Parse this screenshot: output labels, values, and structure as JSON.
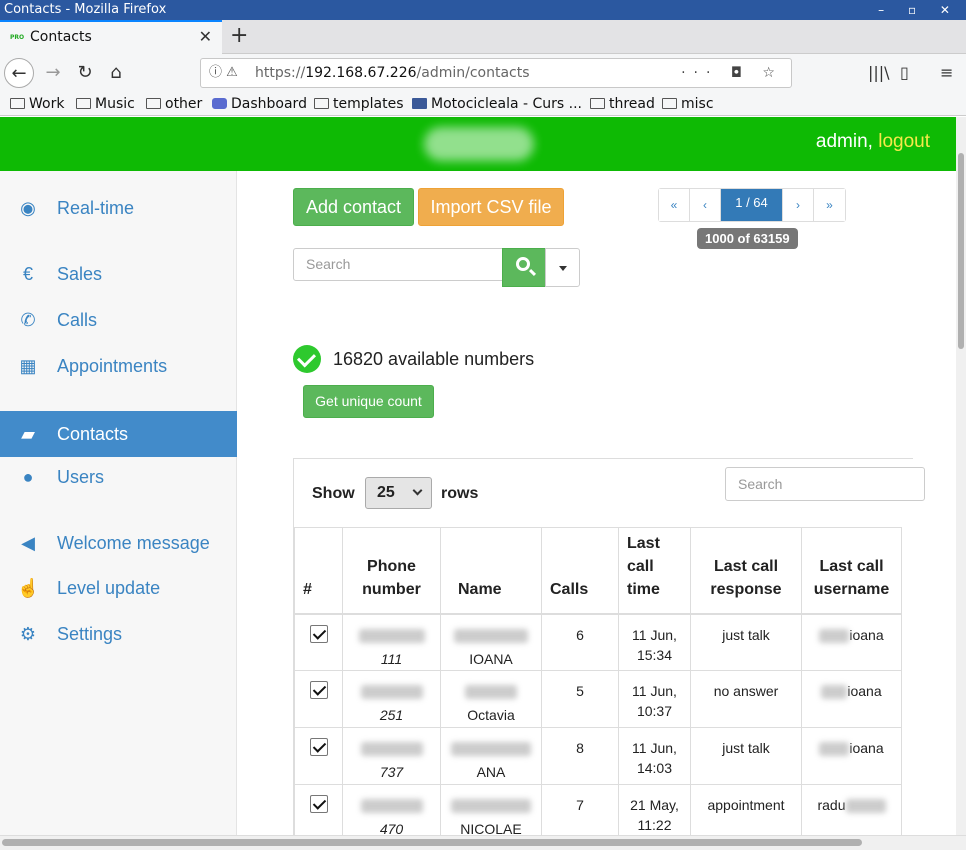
{
  "window": {
    "title": "Contacts - Mozilla Firefox"
  },
  "tab": {
    "title": "Contacts",
    "favicon_text": "PRO"
  },
  "url": {
    "prefix": "https://",
    "host": "192.168.67.226",
    "path": "/admin/contacts"
  },
  "bookmarks": [
    "Work",
    "Music",
    "other",
    "Dashboard",
    "templates",
    "Motocicleala - Curs ...",
    "thread",
    "misc"
  ],
  "header": {
    "user": "admin,",
    "logout": "logout",
    "color": "#0eba04"
  },
  "sidebar": {
    "items": [
      {
        "label": "Real-time",
        "icon": "eye-icon"
      },
      {
        "label": "Sales",
        "icon": "euro-icon"
      },
      {
        "label": "Calls",
        "icon": "phone-icon"
      },
      {
        "label": "Appointments",
        "icon": "calendar-icon"
      },
      {
        "label": "Contacts",
        "icon": "briefcase-icon",
        "active": true
      },
      {
        "label": "Users",
        "icon": "user-icon"
      },
      {
        "label": "Welcome message",
        "icon": "megaphone-icon"
      },
      {
        "label": "Level update",
        "icon": "thumbs-up-icon"
      },
      {
        "label": "Settings",
        "icon": "gear-icon"
      }
    ]
  },
  "toolbar": {
    "add_contact": "Add contact",
    "import_csv": "Import CSV file",
    "search_placeholder": "Search"
  },
  "pagination": {
    "first": "«",
    "prev": "‹",
    "current": "1 / 64",
    "next": "›",
    "last": "»",
    "count_badge": "1000 of 63159"
  },
  "available": {
    "text": "16820 available numbers",
    "unique_button": "Get unique count"
  },
  "table": {
    "show_label": "Show",
    "rows_value": "25",
    "rows_label": "rows",
    "search_placeholder": "Search",
    "columns": [
      "#",
      "Phone number",
      "Name",
      "Calls",
      "Last call time",
      "Last call response",
      "Last call username"
    ],
    "rows": [
      {
        "phone_suffix": "111",
        "name": "IOANA",
        "calls": "6",
        "time": "11 Jun, 15:34",
        "response": "just talk",
        "username": "ioana"
      },
      {
        "phone_suffix": "251",
        "name": "Octavia",
        "calls": "5",
        "time": "11 Jun, 10:37",
        "response": "no answer",
        "username": "ioana"
      },
      {
        "phone_suffix": "737",
        "name": "ANA",
        "calls": "8",
        "time": "11 Jun, 14:03",
        "response": "just talk",
        "username": "ioana"
      },
      {
        "phone_suffix": "470",
        "name": "NICOLAE",
        "calls": "7",
        "time": "21 May, 11:22",
        "response": "appointment",
        "username": "radu"
      }
    ]
  }
}
